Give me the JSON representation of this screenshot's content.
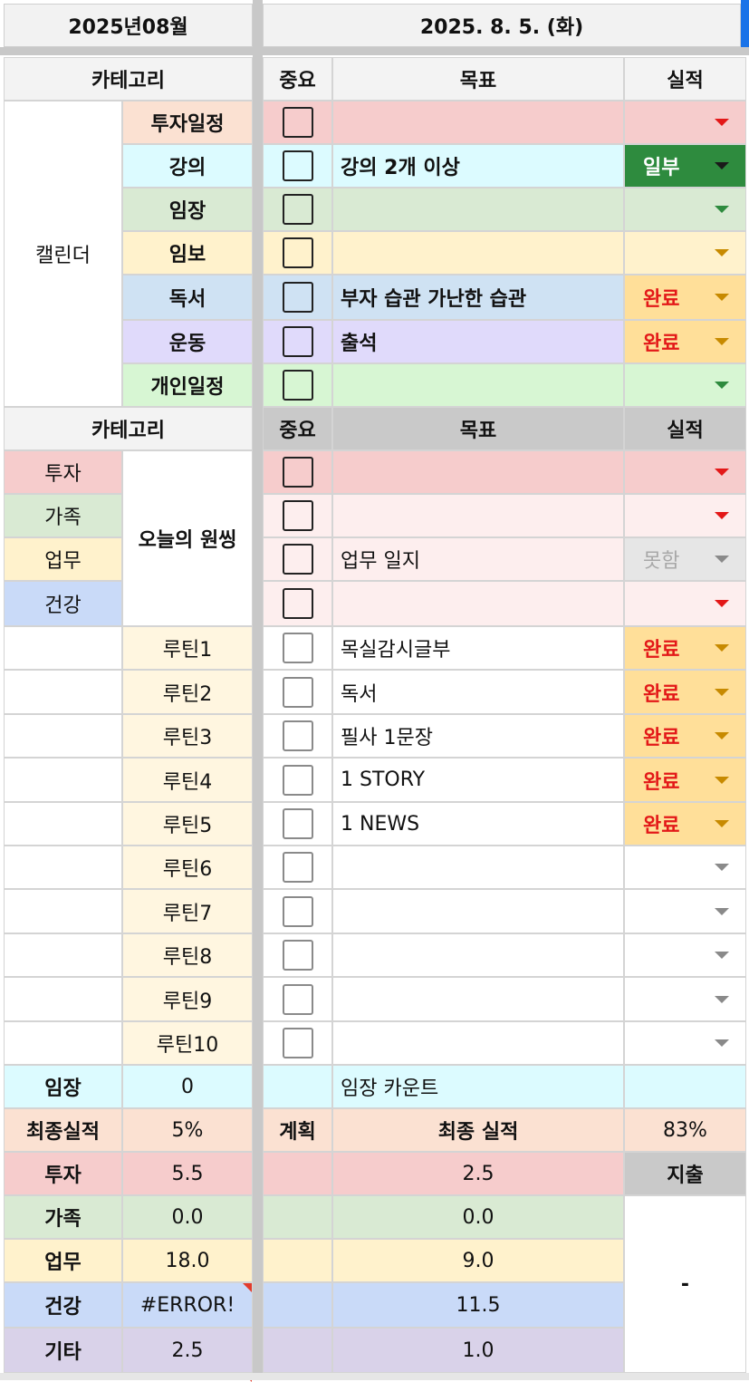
{
  "header": {
    "month": "2025년08월",
    "date": "2025. 8. 5. (화)"
  },
  "colors": {
    "invest": "#f6cccc",
    "invest_light": "#fdeeee",
    "lecture": "#dcfbff",
    "imjang": "#d9ead3",
    "imbo": "#fff2cc",
    "reading": "#cfe2f3",
    "exercise": "#e0dafb",
    "personal": "#d7f6d3",
    "done": "#ffdf99",
    "partial": "#2e8b3e",
    "routine": "#fff6e0"
  },
  "calendar": {
    "header": {
      "category": "카테고리",
      "importance": "중요",
      "goal": "목표",
      "result": "실적"
    },
    "group_label": "캘린더",
    "rows": [
      {
        "category": "투자일정",
        "goal": "",
        "result": ""
      },
      {
        "category": "강의",
        "goal": "강의 2개 이상",
        "result": "일부"
      },
      {
        "category": "임장",
        "goal": "",
        "result": ""
      },
      {
        "category": "임보",
        "goal": "",
        "result": ""
      },
      {
        "category": "독서",
        "goal": "부자 습관 가난한 습관",
        "result": "완료"
      },
      {
        "category": "운동",
        "goal": "출석",
        "result": "완료"
      },
      {
        "category": "개인일정",
        "goal": "",
        "result": ""
      }
    ]
  },
  "daily": {
    "header": {
      "category": "카테고리",
      "importance": "중요",
      "goal": "목표",
      "result": "실적"
    },
    "side_tags": [
      "투자",
      "가족",
      "업무",
      "건강"
    ],
    "one_thing_label": "오늘의 원씽",
    "one_thing_rows": [
      {
        "goal": "",
        "result": ""
      },
      {
        "goal": "",
        "result": ""
      },
      {
        "goal": "업무 일지",
        "result": "못함"
      },
      {
        "goal": "",
        "result": ""
      }
    ],
    "routines": [
      {
        "label": "루틴1",
        "goal": "목실감시글부",
        "result": "완료"
      },
      {
        "label": "루틴2",
        "goal": "독서",
        "result": "완료"
      },
      {
        "label": "루틴3",
        "goal": "필사 1문장",
        "result": "완료"
      },
      {
        "label": "루틴4",
        "goal": "1 STORY",
        "result": "완료"
      },
      {
        "label": "루틴5",
        "goal": "1 NEWS",
        "result": "완료"
      },
      {
        "label": "루틴6",
        "goal": "",
        "result": ""
      },
      {
        "label": "루틴7",
        "goal": "",
        "result": ""
      },
      {
        "label": "루틴8",
        "goal": "",
        "result": ""
      },
      {
        "label": "루틴9",
        "goal": "",
        "result": ""
      },
      {
        "label": "루틴10",
        "goal": "",
        "result": ""
      }
    ]
  },
  "summary": {
    "imjang": {
      "label": "임장",
      "value": "0",
      "goal_label": "임장 카운트"
    },
    "final": {
      "label": "최종실적",
      "value": "5%",
      "plan_label": "계획",
      "final_label": "최종 실적",
      "final_value": "83%"
    },
    "expense_label": "지출",
    "expense_value": "-",
    "rows": [
      {
        "label": "투자",
        "plan": "5.5",
        "actual": "2.5"
      },
      {
        "label": "가족",
        "plan": "0.0",
        "actual": "0.0"
      },
      {
        "label": "업무",
        "plan": "18.0",
        "actual": "9.0"
      },
      {
        "label": "건강",
        "plan": "#ERROR!",
        "actual": "11.5"
      },
      {
        "label": "기타",
        "plan": "2.5",
        "actual": "1.0"
      }
    ]
  }
}
